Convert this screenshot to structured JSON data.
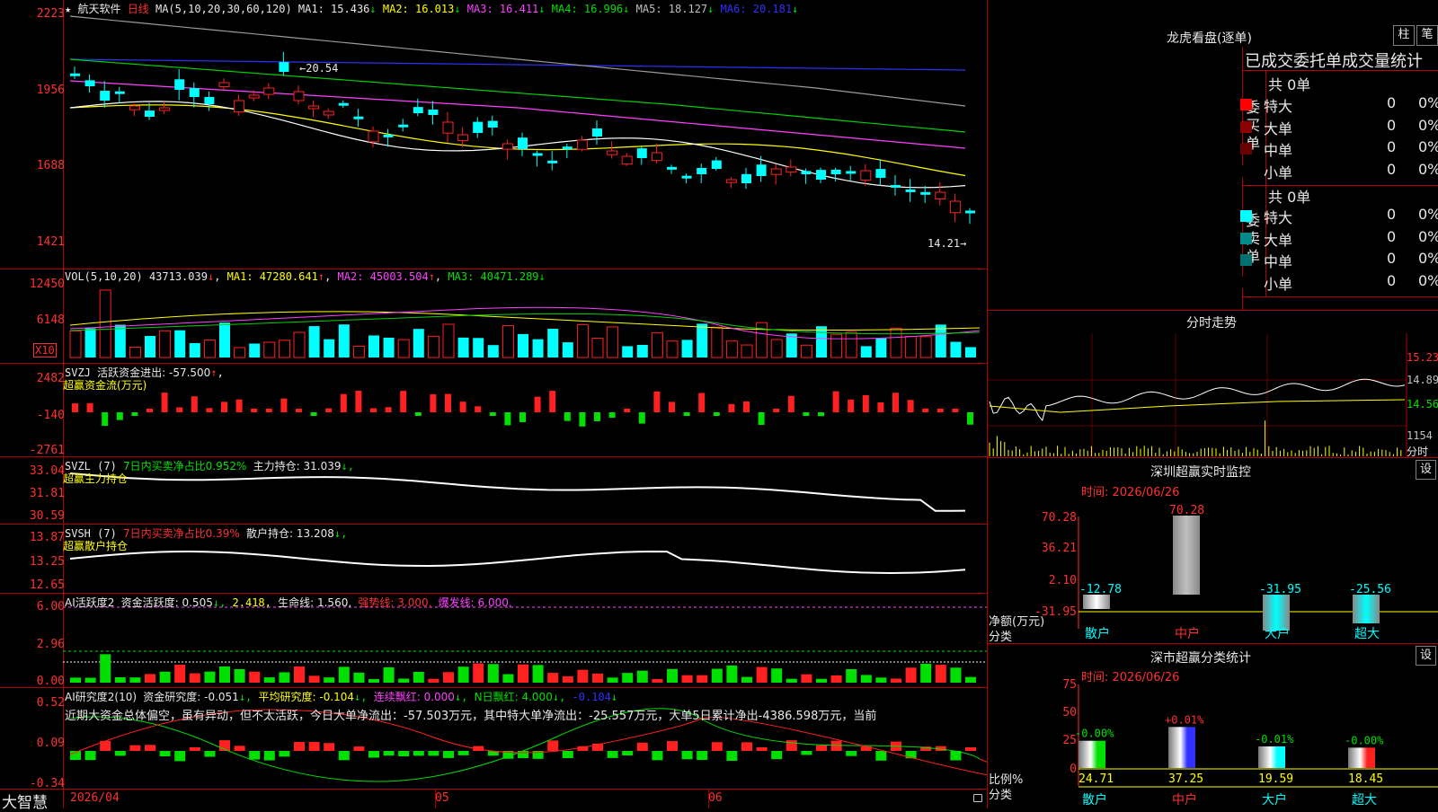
{
  "app": {
    "logo": "大智慧"
  },
  "main_chart": {
    "star": "★",
    "stock_name": "航天软件",
    "period": "日线",
    "ma_label": "MA(5,10,20,30,60,120)",
    "ma_values": [
      {
        "label": "MA1:",
        "value": "15.436",
        "arrow": "↓",
        "color": "#e8e8e8"
      },
      {
        "label": "MA2:",
        "value": "16.013",
        "arrow": "↓",
        "color": "#ffff00"
      },
      {
        "label": "MA3:",
        "value": "16.411",
        "arrow": "↓",
        "color": "#ff40ff"
      },
      {
        "label": "MA4:",
        "value": "16.996",
        "arrow": "↓",
        "color": "#00e000"
      },
      {
        "label": "MA5:",
        "value": "18.127",
        "arrow": "↓",
        "color": "#c0c0c0"
      },
      {
        "label": "MA6:",
        "value": "20.181",
        "arrow": "↓",
        "color": "#3030ff"
      }
    ],
    "y_ticks": [
      "2223",
      "1956",
      "1688",
      "1421"
    ],
    "high_label": "20.54",
    "low_label": "14.21"
  },
  "volume": {
    "header": "VOL(5,10,20)",
    "value": "43713.039",
    "arrow": "↓",
    "ma1": "MA1: 47280.641",
    "ma1_arrow": "↑",
    "ma2": "MA2: 45003.504",
    "ma2_arrow": "↑",
    "ma3": "MA3: 40471.289",
    "ma3_arrow": "↓",
    "y_ticks": [
      "12450",
      "6148"
    ],
    "unit": "X10"
  },
  "svzj": {
    "name": "SVZJ",
    "label": "活跃资金进出: -57.500",
    "arrow": "↑",
    "sub": "超赢资金流(万元)",
    "y_ticks": [
      "2482",
      "-140",
      "-2761"
    ]
  },
  "svzl": {
    "name": "SVZL (7)",
    "ratio": "7日内买卖净占比0.952%",
    "hold": "主力持仓: 31.039",
    "arrow": "↓,",
    "sub": "超赢主力持仓",
    "y_ticks": [
      "33.04",
      "31.81",
      "30.59"
    ]
  },
  "svsh": {
    "name": "SVSH (7)",
    "ratio": "7日内买卖净占比0.39%",
    "hold": "散户持仓: 13.208",
    "arrow": "↓,",
    "sub": "超赢散户持仓",
    "y_ticks": [
      "13.87",
      "13.25",
      "12.65"
    ]
  },
  "ai_active": {
    "name": "AI活跃度2",
    "degree": "资金活跃度: 0.505",
    "arrow1": "↓,",
    "val2": "2.418,",
    "life": "生命线: 1.560,",
    "strong": "强势线: 3.000,",
    "burst": "爆发线: 6.000,",
    "y_ticks": [
      "6.00",
      "2.96",
      "0.00"
    ]
  },
  "ai_research": {
    "name": "AI研究度2(10)",
    "degree": "资金研究度: -0.051",
    "arrow1": "↓,",
    "avg": "平均研究度: -0.104",
    "arrow2": "↓,",
    "cont": "连续飘红: 0.000",
    "arrow3": "↓,",
    "nday": "N日飘红: 4.000",
    "arrow4": "↓,",
    "last": "-0.104",
    "arrow5": "↓",
    "summary": "近期大资金总体偏空，虽有异动，但不太活跃，今日大单净流出：-57.503万元，其中特大单净流出：-25.557万元，大单5日累计净出-4386.598万元，当前",
    "y_ticks": [
      "0.52",
      "0.09",
      "-0.34"
    ]
  },
  "x_axis": {
    "labels": [
      "2026/04",
      "05",
      "06"
    ]
  },
  "dragon_tiger": {
    "title": "龙虎看盘(逐单)",
    "btn_bar": "柱",
    "btn_pen": "笔",
    "heading": "已成交委托单成交量统计",
    "buy": {
      "side_label": "委买单",
      "total": "共 0单",
      "rows": [
        {
          "label": "特大",
          "count": "0",
          "pct": "0%",
          "color": "#ff0000"
        },
        {
          "label": "大单",
          "count": "0",
          "pct": "0%",
          "color": "#8b0000"
        },
        {
          "label": "中单",
          "count": "0",
          "pct": "0%",
          "color": "#6b0000"
        },
        {
          "label": "小单",
          "count": "0",
          "pct": "0%",
          "color": "#000000"
        }
      ]
    },
    "sell": {
      "side_label": "委卖单",
      "total": "共 0单",
      "rows": [
        {
          "label": "特大",
          "count": "0",
          "pct": "0%",
          "color": "#00ffff"
        },
        {
          "label": "大单",
          "count": "0",
          "pct": "0%",
          "color": "#008b8b"
        },
        {
          "label": "中单",
          "count": "0",
          "pct": "0%",
          "color": "#007070"
        },
        {
          "label": "小单",
          "count": "0",
          "pct": "0%",
          "color": "#000000"
        }
      ]
    }
  },
  "intraday": {
    "title": "分时走势",
    "y_ticks": [
      "15.23",
      "14.89",
      "14.56"
    ],
    "vol_tick": "1154",
    "vol_label": "分时"
  },
  "sz_realtime": {
    "title": "深圳超赢实时监控",
    "settings": "设",
    "time": "时间: 2026/06/26",
    "y_ticks": [
      "70.28",
      "36.21",
      "2.10",
      "-31.95"
    ],
    "y_label_1": "净额(万元)",
    "y_label_2": "分类",
    "categories": [
      "散户",
      "中户",
      "大户",
      "超大"
    ],
    "values": [
      -12.78,
      70.28,
      -31.95,
      -25.56
    ],
    "value_labels": [
      "-12.78",
      "70.28",
      "-31.95",
      "-25.56"
    ]
  },
  "sz_category": {
    "title": "深市超赢分类统计",
    "settings": "设",
    "time": "时间: 2026/06/26",
    "y_ticks": [
      "75",
      "50",
      "25",
      "0"
    ],
    "y_label_1": "比例%",
    "y_label_2": "分类",
    "categories": [
      "散户",
      "中户",
      "大户",
      "超大"
    ],
    "values": [
      24.71,
      37.25,
      19.59,
      18.45
    ],
    "value_labels": [
      "24.71",
      "37.25",
      "19.59",
      "18.45"
    ],
    "change_labels": [
      "-0.00%",
      "+0.01%",
      "-0.01%",
      "-0.00%"
    ]
  }
}
